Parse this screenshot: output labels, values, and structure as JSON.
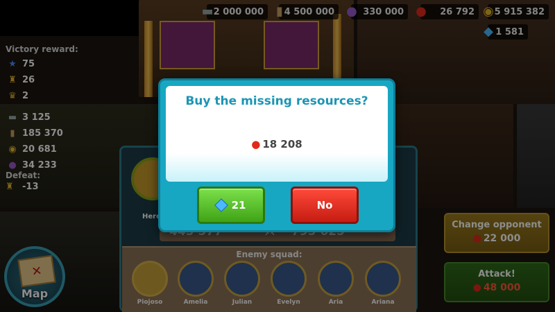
{
  "resources": {
    "iron": {
      "icon": "iron-ingot-icon",
      "value": "2 000 000"
    },
    "wood": {
      "icon": "wood-log-icon",
      "value": "4 500 000"
    },
    "potion": {
      "icon": "potion-icon",
      "value": "330 000"
    },
    "food": {
      "icon": "apple-icon",
      "value": "26 792"
    },
    "gold": {
      "icon": "gold-coin-icon",
      "value": "5 915 382"
    },
    "gems": {
      "icon": "gem-icon",
      "value": "1 581"
    }
  },
  "reward": {
    "header": "Victory reward:",
    "items": [
      {
        "icon": "star-icon",
        "value": "75"
      },
      {
        "icon": "trophy-icon",
        "value": "26"
      },
      {
        "icon": "crown-icon",
        "value": "2"
      },
      {
        "icon": "iron-ingot-icon",
        "value": "3 125"
      },
      {
        "icon": "wood-log-icon",
        "value": "185 370"
      },
      {
        "icon": "gold-coin-icon",
        "value": "20 681"
      },
      {
        "icon": "potion-icon",
        "value": "34 233"
      }
    ],
    "defeat_label": "Defeat:",
    "defeat_value": "-13"
  },
  "panel": {
    "hero_label": "Hero",
    "left_total": "445 577",
    "right_total": "795 625",
    "squad_title": "Enemy squad:",
    "squad": [
      "Piojoso",
      "Amelia",
      "Julian",
      "Evelyn",
      "Aria",
      "Ariana"
    ]
  },
  "map": {
    "label": "Map"
  },
  "change_opponent": {
    "label": "Change opponent",
    "cost": "22 000"
  },
  "attack": {
    "label": "Attack!",
    "cost": "48 000"
  },
  "dialog": {
    "title": "Buy the missing resources?",
    "missing_amount": "18 208",
    "yes_label": "21",
    "no_label": "No"
  },
  "colors": {
    "dialog_bg": "#17a7c3",
    "yes_button": "#4fbd22",
    "no_button": "#e02a1a",
    "title_text": "#1b95b5"
  }
}
